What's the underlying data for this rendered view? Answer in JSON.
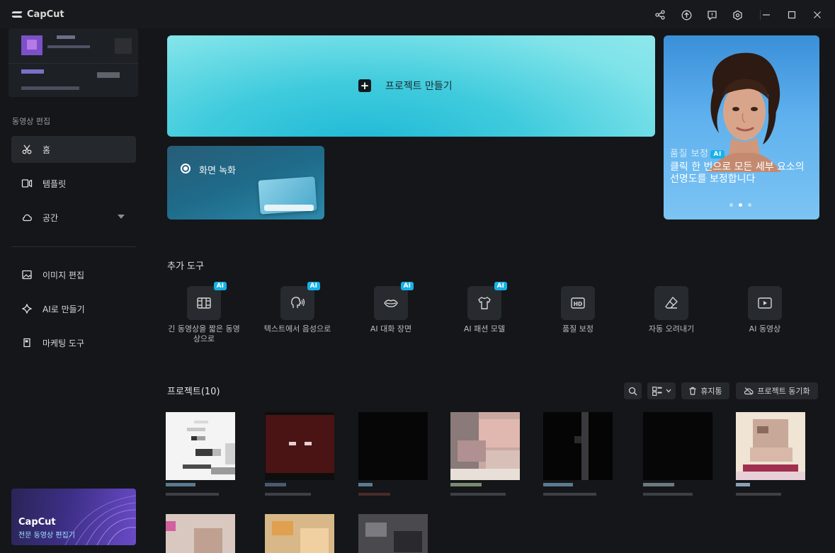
{
  "app": {
    "name": "CapCut"
  },
  "sidebar": {
    "section_title": "동영상 편집",
    "nav": [
      {
        "label": "홈",
        "icon": "scissors-icon"
      },
      {
        "label": "템플릿",
        "icon": "template-icon"
      },
      {
        "label": "공간",
        "icon": "cloud-icon"
      }
    ],
    "tools": [
      {
        "label": "이미지 편집",
        "icon": "image-icon"
      },
      {
        "label": "AI로 만들기",
        "icon": "sparkle-icon"
      },
      {
        "label": "마케팅 도구",
        "icon": "marketing-icon"
      }
    ],
    "promo": {
      "title": "CapCut",
      "subtitle": "전문 동영상 편집기"
    }
  },
  "main": {
    "create_project": "프로젝트 만들기",
    "screen_record": "화면 녹화",
    "banner": {
      "title": "품질 보정",
      "badge": "AI",
      "text": "클릭 한 번으로 모든 세부 요소의 선명도를 보정합니다"
    },
    "tools_title": "추가 도구",
    "tools": [
      {
        "label": "긴 동영상을 짧은 동영상으로",
        "ai": "AI"
      },
      {
        "label": "텍스트에서 음성으로",
        "ai": "AI"
      },
      {
        "label": "AI 대화 장면",
        "ai": "AI"
      },
      {
        "label": "AI 패션 모델",
        "ai": "AI"
      },
      {
        "label": "품질 보정",
        "ai": ""
      },
      {
        "label": "자동 오려내기",
        "ai": ""
      },
      {
        "label": "AI 동영상",
        "ai": ""
      }
    ],
    "projects_title": "프로젝트(10)",
    "trash_label": "휴지통",
    "sync_label": "프로젝트 동기화"
  },
  "colors": {
    "accent": "#16b1e6",
    "background": "#141619"
  }
}
